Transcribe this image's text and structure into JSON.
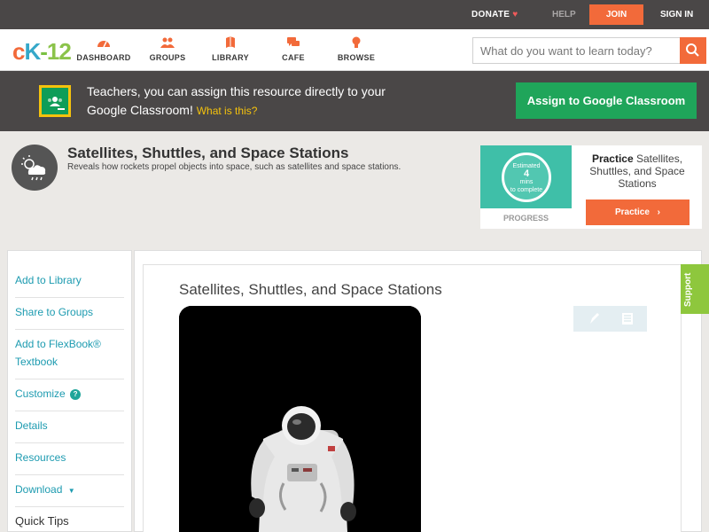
{
  "topbar": {
    "donate": "DONATE",
    "help": "HELP",
    "join": "JOIN",
    "signin": "SIGN IN"
  },
  "logo": {
    "c": "c",
    "k": "K",
    "dash": "-",
    "n": "12"
  },
  "nav": {
    "items": [
      {
        "label": "DASHBOARD",
        "icon": "dashboard-icon"
      },
      {
        "label": "GROUPS",
        "icon": "groups-icon"
      },
      {
        "label": "LIBRARY",
        "icon": "library-icon"
      },
      {
        "label": "CAFE",
        "icon": "cafe-icon"
      },
      {
        "label": "BROWSE",
        "icon": "browse-icon"
      }
    ]
  },
  "search": {
    "placeholder": "What do you want to learn today?"
  },
  "banner": {
    "text": "Teachers, you can assign this resource directly to your Google Classroom!",
    "link": "What is this?",
    "button": "Assign to Google Classroom"
  },
  "header": {
    "title": "Satellites, Shuttles, and Space Stations",
    "description": "Reveals how rockets propel objects into space, such as satellites and space stations.",
    "progress": {
      "line1": "Estimated",
      "minutes": "4",
      "line3": "mins",
      "line4": "to complete",
      "label": "PROGRESS"
    },
    "practice": {
      "bold": "Practice",
      "rest": "Satellites, Shuttles, and Space Stations",
      "button": "Practice"
    }
  },
  "sidebar": {
    "items": [
      {
        "label": "Add to Library"
      },
      {
        "label": "Share to Groups"
      },
      {
        "label": "Add to FlexBook® Textbook"
      },
      {
        "label": "Customize"
      },
      {
        "label": "Details"
      },
      {
        "label": "Resources"
      },
      {
        "label": "Download"
      }
    ],
    "customize_badge": "?",
    "quick_tips": "Quick Tips"
  },
  "content": {
    "title": "Satellites, Shuttles, and Space Stations",
    "support": "Support"
  },
  "colors": {
    "accent": "#f26a3a",
    "teal": "#1d9bb0",
    "green": "#1fa55a",
    "dark": "#4a4747"
  }
}
